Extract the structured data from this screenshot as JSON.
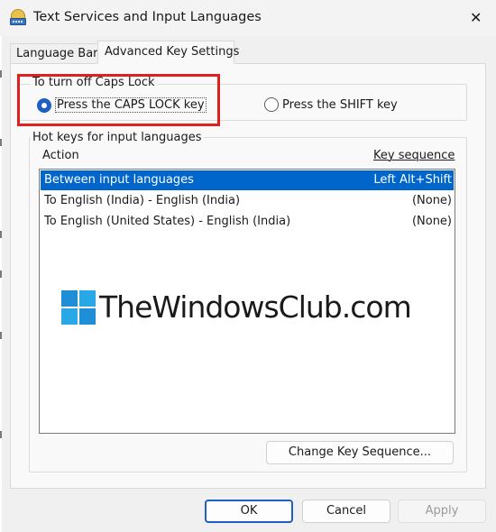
{
  "window": {
    "title": "Text Services and Input Languages",
    "close_glyph": "✕"
  },
  "tabs": [
    {
      "label": "Language Bar",
      "active": false
    },
    {
      "label": "Advanced Key Settings",
      "active": true
    }
  ],
  "caps_lock": {
    "group_label": "To turn off Caps Lock",
    "options": [
      {
        "label": "Press the CAPS LOCK key",
        "checked": true
      },
      {
        "label": "Press the SHIFT key",
        "checked": false
      }
    ]
  },
  "hotkeys": {
    "group_label": "Hot keys for input languages",
    "columns": {
      "action": "Action",
      "key_sequence": "Key sequence"
    },
    "rows": [
      {
        "action": "Between input languages",
        "key": "Left Alt+Shift",
        "selected": true
      },
      {
        "action": "To English (India) - English (India)",
        "key": "(None)",
        "selected": false
      },
      {
        "action": "To English (United States) - English (India)",
        "key": "(None)",
        "selected": false
      }
    ],
    "change_button": "Change Key Sequence..."
  },
  "watermark": {
    "text": "TheWindowsClub.com"
  },
  "footer": {
    "ok": "OK",
    "cancel": "Cancel",
    "apply": "Apply"
  },
  "colors": {
    "accent": "#1f5ec4",
    "selection": "#0066cc",
    "highlight_border": "#e0201e",
    "logo_blue": "#1e8fd6"
  },
  "icons": {
    "app": "keyboard-book-icon",
    "close": "close-icon",
    "logo": "windows-logo-icon"
  }
}
